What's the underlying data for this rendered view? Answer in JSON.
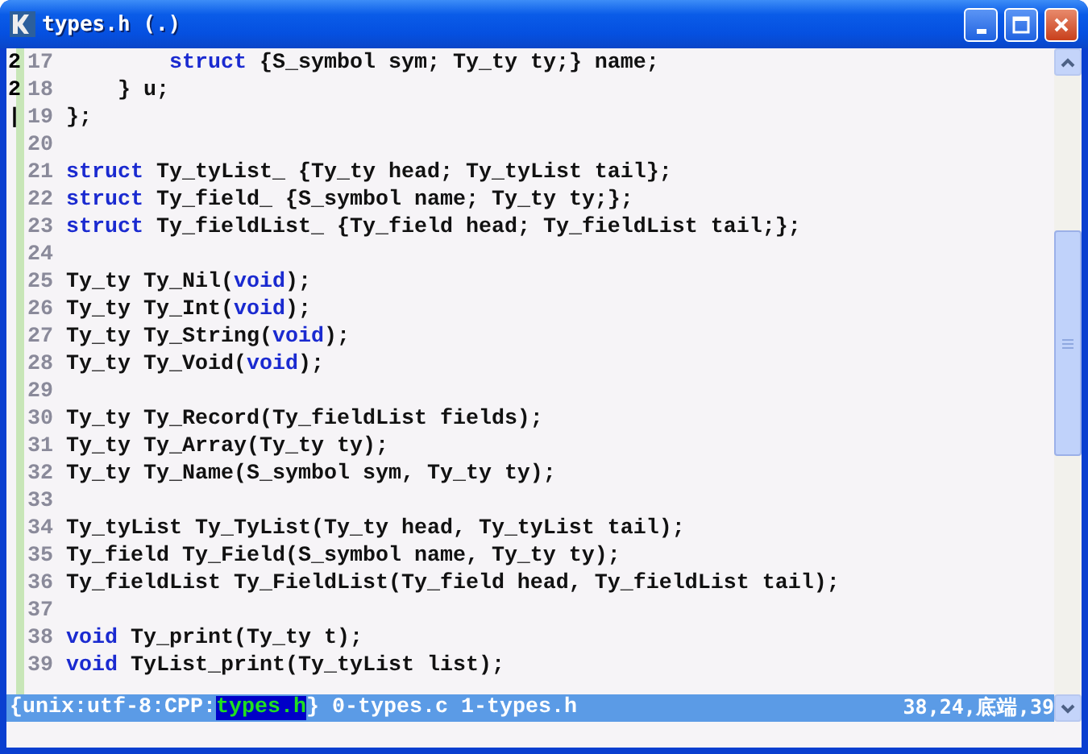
{
  "window": {
    "title": "types.h (.)"
  },
  "lines": [
    {
      "fold": "2",
      "number": "17",
      "segments": [
        {
          "kind": "keyword",
          "text": "        struct"
        },
        {
          "kind": "plain",
          "text": " {S_symbol sym; Ty_ty ty;} name;"
        }
      ]
    },
    {
      "fold": "2",
      "number": "18",
      "segments": [
        {
          "kind": "plain",
          "text": "    } u;"
        }
      ]
    },
    {
      "fold": "|",
      "number": "19",
      "segments": [
        {
          "kind": "plain",
          "text": "};"
        }
      ]
    },
    {
      "number": "20"
    },
    {
      "number": "21",
      "segments": [
        {
          "kind": "keyword",
          "text": "struct"
        },
        {
          "kind": "plain",
          "text": " Ty_tyList_ {Ty_ty head; Ty_tyList tail};"
        }
      ]
    },
    {
      "number": "22",
      "segments": [
        {
          "kind": "keyword",
          "text": "struct"
        },
        {
          "kind": "plain",
          "text": " Ty_field_ {S_symbol name; Ty_ty ty;};"
        }
      ]
    },
    {
      "number": "23",
      "segments": [
        {
          "kind": "keyword",
          "text": "struct"
        },
        {
          "kind": "plain",
          "text": " Ty_fieldList_ {Ty_field head; Ty_fieldList tail;};"
        }
      ]
    },
    {
      "number": "24"
    },
    {
      "number": "25",
      "segments": [
        {
          "kind": "plain",
          "text": "Ty_ty Ty_Nil("
        },
        {
          "kind": "keyword",
          "text": "void"
        },
        {
          "kind": "plain",
          "text": ");"
        }
      ]
    },
    {
      "number": "26",
      "segments": [
        {
          "kind": "plain",
          "text": "Ty_ty Ty_Int("
        },
        {
          "kind": "keyword",
          "text": "void"
        },
        {
          "kind": "plain",
          "text": ");"
        }
      ]
    },
    {
      "number": "27",
      "segments": [
        {
          "kind": "plain",
          "text": "Ty_ty Ty_String("
        },
        {
          "kind": "keyword",
          "text": "void"
        },
        {
          "kind": "plain",
          "text": ");"
        }
      ]
    },
    {
      "number": "28",
      "segments": [
        {
          "kind": "plain",
          "text": "Ty_ty Ty_Void("
        },
        {
          "kind": "keyword",
          "text": "void"
        },
        {
          "kind": "plain",
          "text": ");"
        }
      ]
    },
    {
      "number": "29"
    },
    {
      "number": "30",
      "segments": [
        {
          "kind": "plain",
          "text": "Ty_ty Ty_Record(Ty_fieldList fields);"
        }
      ]
    },
    {
      "number": "31",
      "segments": [
        {
          "kind": "plain",
          "text": "Ty_ty Ty_Array(Ty_ty ty);"
        }
      ]
    },
    {
      "number": "32",
      "segments": [
        {
          "kind": "plain",
          "text": "Ty_ty Ty_Name(S_symbol sym, Ty_ty ty);"
        }
      ]
    },
    {
      "number": "33"
    },
    {
      "number": "34",
      "segments": [
        {
          "kind": "plain",
          "text": "Ty_tyList Ty_TyList(Ty_ty head, Ty_tyList tail);"
        }
      ]
    },
    {
      "number": "35",
      "segments": [
        {
          "kind": "plain",
          "text": "Ty_field Ty_Field(S_symbol name, Ty_ty ty);"
        }
      ]
    },
    {
      "number": "36",
      "segments": [
        {
          "kind": "plain",
          "text": "Ty_fieldList Ty_FieldList(Ty_field head, Ty_fieldList tail);"
        }
      ]
    },
    {
      "number": "37"
    },
    {
      "number": "38",
      "segments": [
        {
          "kind": "keyword",
          "text": "void"
        },
        {
          "kind": "plain",
          "text": " Ty_print(Ty_ty t);"
        }
      ]
    },
    {
      "number": "39",
      "segments": [
        {
          "kind": "keyword",
          "text": "void"
        },
        {
          "kind": "plain",
          "text": " TyList_print(Ty_tyList list);"
        }
      ]
    }
  ],
  "status_bar": {
    "prefix": "{unix:utf-8:CPP:",
    "current_buffer": "types.h",
    "suffix": "} 0-types.c 1-types.h",
    "position": "38,24,底端,39"
  }
}
